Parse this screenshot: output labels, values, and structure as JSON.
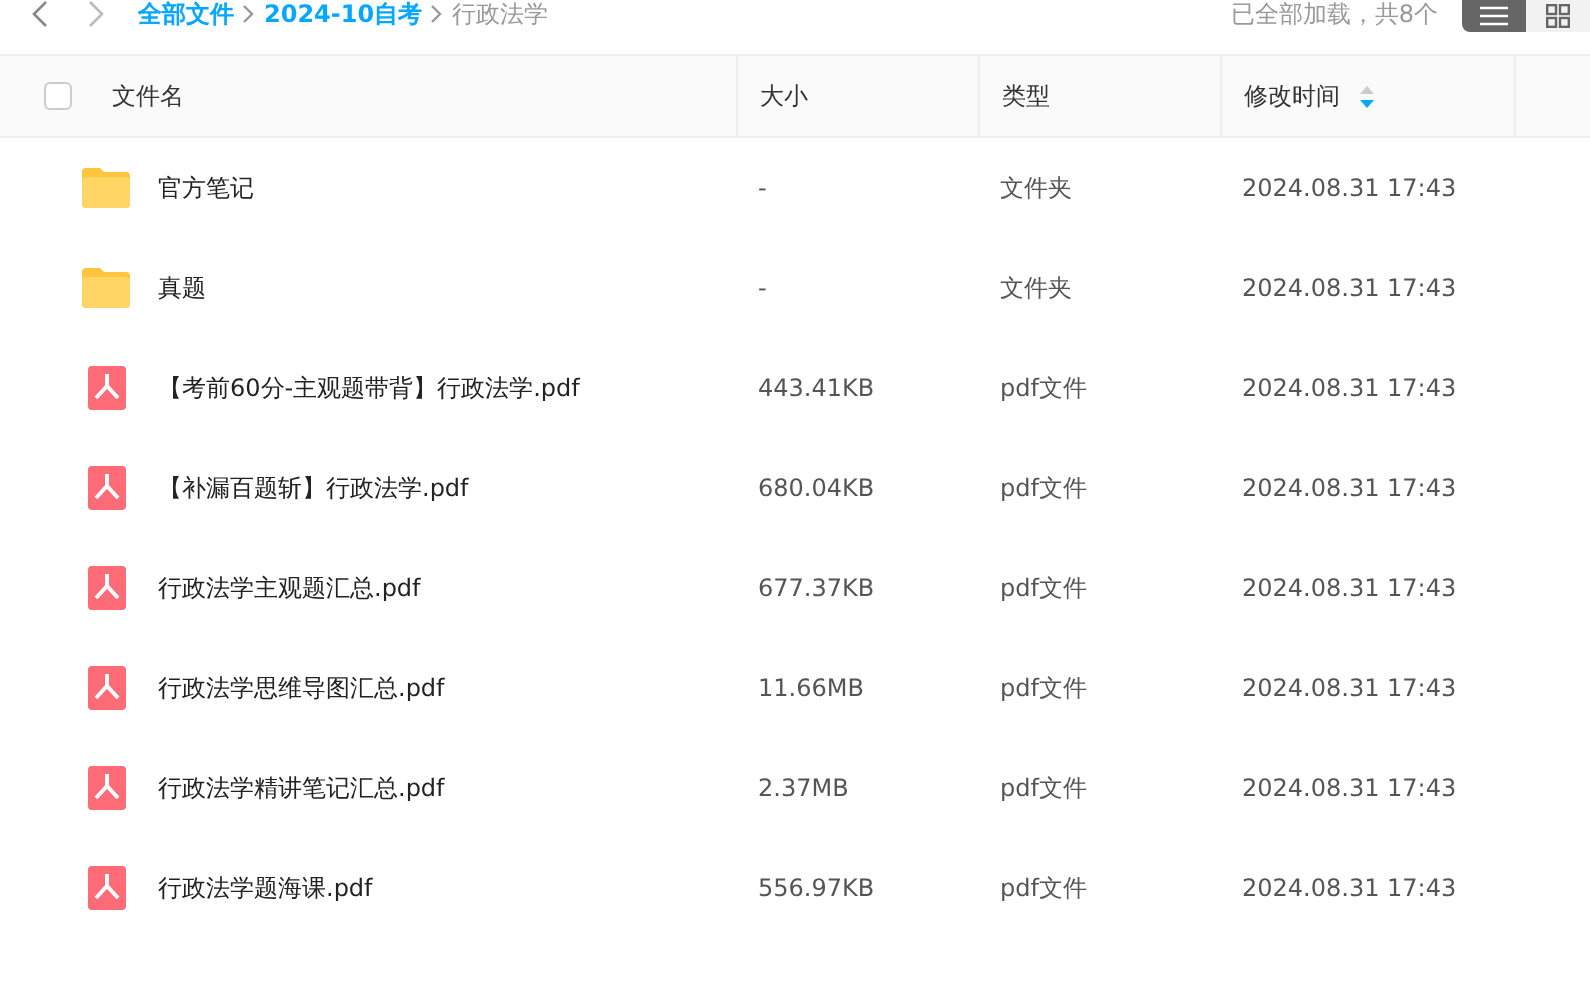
{
  "breadcrumb": [
    {
      "label": "全部文件",
      "link": true
    },
    {
      "label": "2024-10自考",
      "link": true
    },
    {
      "label": "行政法学",
      "link": false
    }
  ],
  "status": "已全部加载，共8个",
  "views": [
    {
      "kind": "list",
      "selected": true
    },
    {
      "kind": "grid",
      "selected": false
    }
  ],
  "select_all": {
    "checked": false
  },
  "columns": [
    {
      "label": "文件名"
    },
    {
      "label": "大小"
    },
    {
      "label": "类型"
    },
    {
      "label": "修改时间",
      "sorted_descending": true
    }
  ],
  "rows": [
    {
      "kind": "folder",
      "name": "官方笔记",
      "size": "-",
      "type": "文件夹",
      "time": "2024.08.31 17:43"
    },
    {
      "kind": "folder",
      "name": "真题",
      "size": "-",
      "type": "文件夹",
      "time": "2024.08.31 17:43"
    },
    {
      "kind": "pdf",
      "name": "【考前60分-主观题带背】行政法学.pdf",
      "size": "443.41KB",
      "type": "pdf文件",
      "time": "2024.08.31 17:43"
    },
    {
      "kind": "pdf",
      "name": "【补漏百题斩】行政法学.pdf",
      "size": "680.04KB",
      "type": "pdf文件",
      "time": "2024.08.31 17:43"
    },
    {
      "kind": "pdf",
      "name": "行政法学主观题汇总.pdf",
      "size": "677.37KB",
      "type": "pdf文件",
      "time": "2024.08.31 17:43"
    },
    {
      "kind": "pdf",
      "name": "行政法学思维导图汇总.pdf",
      "size": "11.66MB",
      "type": "pdf文件",
      "time": "2024.08.31 17:43"
    },
    {
      "kind": "pdf",
      "name": "行政法学精讲笔记汇总.pdf",
      "size": "2.37MB",
      "type": "pdf文件",
      "time": "2024.08.31 17:43"
    },
    {
      "kind": "pdf",
      "name": "行政法学题海课.pdf",
      "size": "556.97KB",
      "type": "pdf文件",
      "time": "2024.08.31 17:43"
    }
  ]
}
